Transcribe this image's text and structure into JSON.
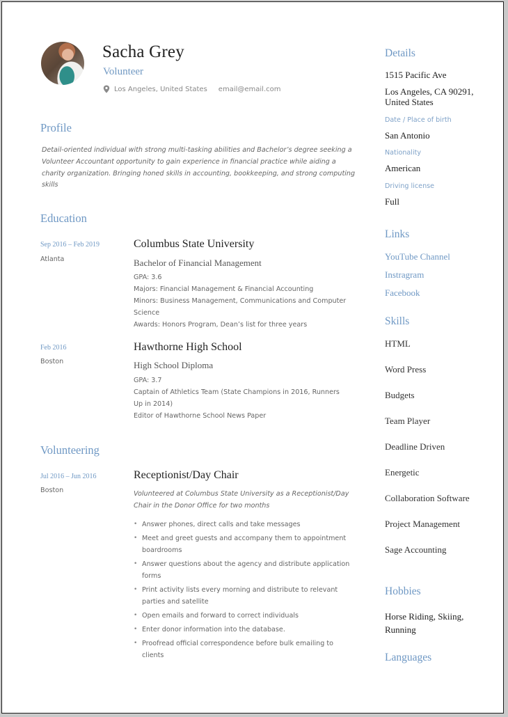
{
  "header": {
    "name": "Sacha Grey",
    "job_title": "Volunteer",
    "location": "Los Angeles, United States",
    "email": "email@email.com",
    "location_icon": "map-pin-icon"
  },
  "profile": {
    "heading": "Profile",
    "text": "Detail-oriented individual with strong multi-tasking abilities and Bachelor’s degree seeking a Volunteer Accountant opportunity to gain experience in financial practice while aiding a charity organization. Bringing honed skills in accounting, bookkeeping, and strong computing skills"
  },
  "education": {
    "heading": "Education",
    "entries": [
      {
        "dates": "Sep 2016 – Feb 2019",
        "place": "Atlanta",
        "school": "Columbus State University",
        "degree": "Bachelor of Financial Management",
        "lines": [
          "GPA: 3.6",
          "Majors: Financial Management & Financial Accounting",
          "Minors: Business Management, Communications and Computer Science",
          "Awards: Honors Program, Dean’s list for three years"
        ]
      },
      {
        "dates": "Feb 2016",
        "place": "Boston",
        "school": "Hawthorne High School",
        "degree": "High School Diploma",
        "lines": [
          "GPA: 3.7",
          "Captain of Athletics Team (State Champions in 2016, Runners Up in 2014)",
          "Editor of Hawthorne School News Paper"
        ]
      }
    ]
  },
  "volunteering": {
    "heading": "Volunteering",
    "entries": [
      {
        "dates": "Jul 2016 – Jun 2016",
        "place": "Boston",
        "role": "Receptionist/Day Chair",
        "summary": "Volunteered at Columbus State University as a Receptionist/Day Chair in the Donor Office for two months",
        "bullets": [
          "Answer phones, direct calls and take messages",
          "Meet and greet guests and accompany them to appointment boardrooms",
          "Answer questions about the agency and distribute application forms",
          "Print activity lists every morning and distribute to relevant parties and satellite",
          "Open emails and forward to correct individuals",
          "Enter donor information into the database.",
          "Proofread official correspondence before bulk emailing to clients"
        ]
      }
    ]
  },
  "sidebar": {
    "details": {
      "heading": "Details",
      "address_line1": "1515 Pacific Ave",
      "address_line2": "Los Angeles, CA 90291,",
      "address_line3": "United States",
      "birth_label": "Date / Place of birth",
      "birth_value": "San Antonio",
      "nationality_label": "Nationality",
      "nationality_value": "American",
      "license_label": "Driving license",
      "license_value": "Full"
    },
    "links": {
      "heading": "Links",
      "items": [
        "YouTube Channel",
        "Instragram",
        "Facebook"
      ]
    },
    "skills": {
      "heading": "Skills",
      "items": [
        "HTML",
        "Word Press",
        "Budgets",
        "Team Player",
        "Deadline Driven",
        "Energetic",
        "Collaboration Software",
        "Project Management",
        "Sage Accounting"
      ]
    },
    "hobbies": {
      "heading": "Hobbies",
      "text": "Horse Riding, Skiing, Running"
    },
    "languages": {
      "heading": "Languages"
    }
  },
  "colors": {
    "accent": "#6f98c4",
    "text_dark": "#222222",
    "text_muted": "#666666",
    "page_border": "#1a1a1a",
    "surround": "#c9c9c9"
  }
}
